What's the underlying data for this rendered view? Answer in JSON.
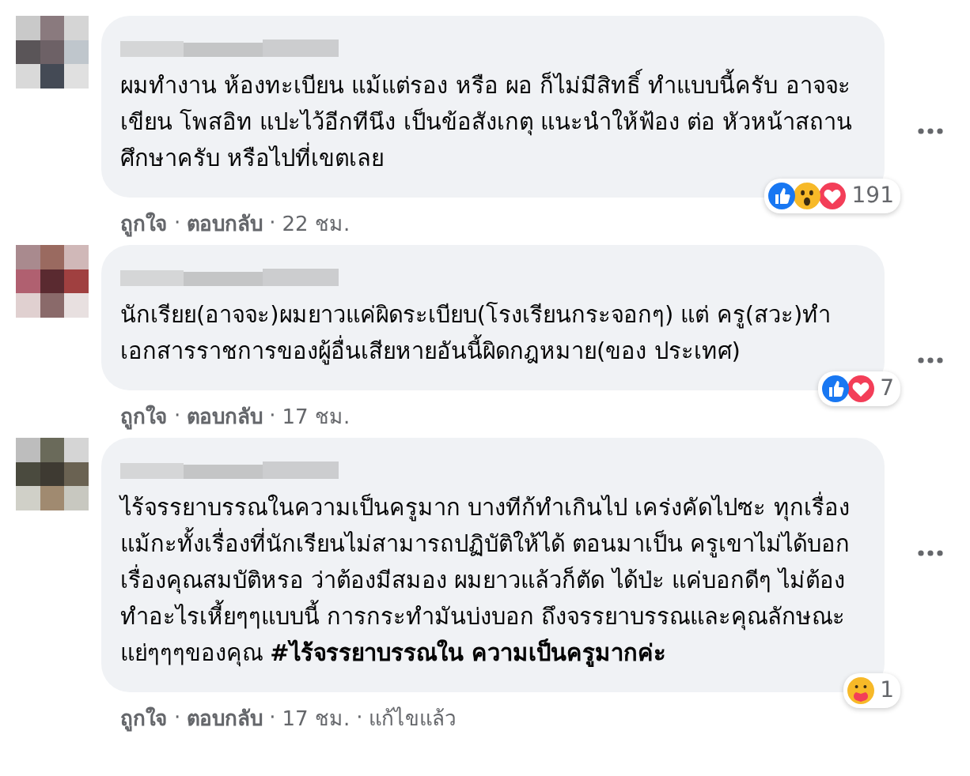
{
  "comments": [
    {
      "text": "ผมทำงาน ห้องทะเบียน แม้แต่รอง หรือ ผอ ก็ไม่มีสิทธิ์ ทำแบบนี้ครับ อาจจะเขียน โพสอิท แปะไว้อีกทีนึง เป็นข้อสังเกตุ แนะนำให้ฟ้อง ต่อ หัวหน้าสถานศึกษาครับ หรือไปที่เขตเลย",
      "reactions": [
        {
          "kind": "like"
        },
        {
          "kind": "wow"
        },
        {
          "kind": "love"
        }
      ],
      "reaction_count": "191",
      "actions": {
        "like": "ถูกใจ",
        "separator": "·",
        "reply": "ตอบกลับ",
        "time": "22 ชม."
      }
    },
    {
      "text": "นักเรียย(อาจจะ)ผมยาวแค่ผิดระเบียบ(โรงเรียนกระจอกๆ) แต่ ครู(สวะ)ทำเอกสารราชการของผู้อื่นเสียหายอันนี้ผิดกฎหมาย(ของ ประเทศ)",
      "reactions": [
        {
          "kind": "like"
        },
        {
          "kind": "love"
        }
      ],
      "reaction_count": "7",
      "actions": {
        "like": "ถูกใจ",
        "separator": "·",
        "reply": "ตอบกลับ",
        "time": "17 ชม."
      }
    },
    {
      "text": "ไร้จรรยาบรรณในความเป็นครูมาก บางทีก้ทำเกินไป เคร่งคัดไปซะ ทุกเรื่อง แม้กะทั้งเรื่องที่นักเรียนไม่สามารถปฏิบัติให้ได้ ตอนมาเป็น ครูเขาไม่ได้บอกเรื่องคุณสมบัติหรอ ว่าต้องมีสมอง ผมยาวแล้วก็ตัด ได้ป่ะ แค่บอกดีๆ ไม่ต้องทำอะไรเหี้ยๆๆแบบนี้ การกระทำมันบ่งบอก ถึงจรรยาบรรณและคุณลักษณะ แย่ๆๆๆของคุณ **#ไร้จรรยาบรรณใน ความเป็นครูมากค่ะ**",
      "reactions": [
        {
          "kind": "care"
        }
      ],
      "reaction_count": "1",
      "actions": {
        "like": "ถูกใจ",
        "separator": "·",
        "reply": "ตอบกลับ",
        "time": "17 ชม.",
        "edited": "แก้ไขแล้ว"
      }
    }
  ]
}
